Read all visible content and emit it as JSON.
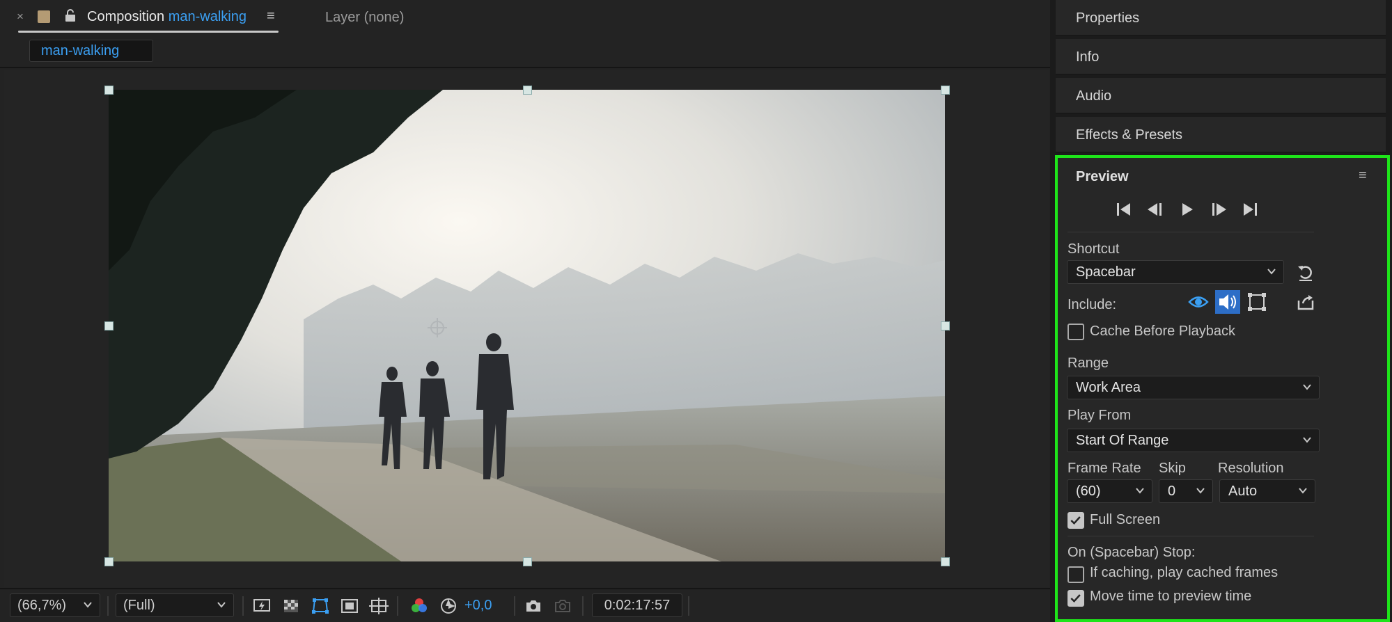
{
  "composition_tab": {
    "close": "×",
    "title_prefix": "Composition",
    "comp_name": "man-walking",
    "menu": "≡",
    "layer_tab": "Layer (none)",
    "sub_tab": "man-walking"
  },
  "viewer_footer": {
    "zoom": "(66,7%)",
    "resolution": "(Full)",
    "exposure": "+0,0",
    "timecode": "0:02:17:57"
  },
  "right_panels": {
    "collapsed": [
      "Properties",
      "Info",
      "Audio",
      "Effects & Presets"
    ]
  },
  "preview": {
    "title": "Preview",
    "menu": "≡",
    "shortcut_label": "Shortcut",
    "shortcut_value": "Spacebar",
    "include_label": "Include:",
    "cache_before_playback": "Cache Before Playback",
    "range_label": "Range",
    "range_value": "Work Area",
    "play_from_label": "Play From",
    "play_from_value": "Start Of Range",
    "frame_rate_label": "Frame Rate",
    "frame_rate_value": "(60)",
    "skip_label": "Skip",
    "skip_value": "0",
    "resolution_label": "Resolution",
    "resolution_value": "Auto",
    "full_screen": "Full Screen",
    "full_screen_checked": true,
    "cache_checked": false,
    "on_stop_label": "On (Spacebar) Stop:",
    "if_caching": "If caching, play cached frames",
    "if_caching_checked": false,
    "move_time": "Move time to preview time",
    "move_time_checked": true
  },
  "colors": {
    "accent_blue": "#3b9ff2",
    "highlight_green": "#1ee41a",
    "label_swatch": "#b49b74"
  }
}
